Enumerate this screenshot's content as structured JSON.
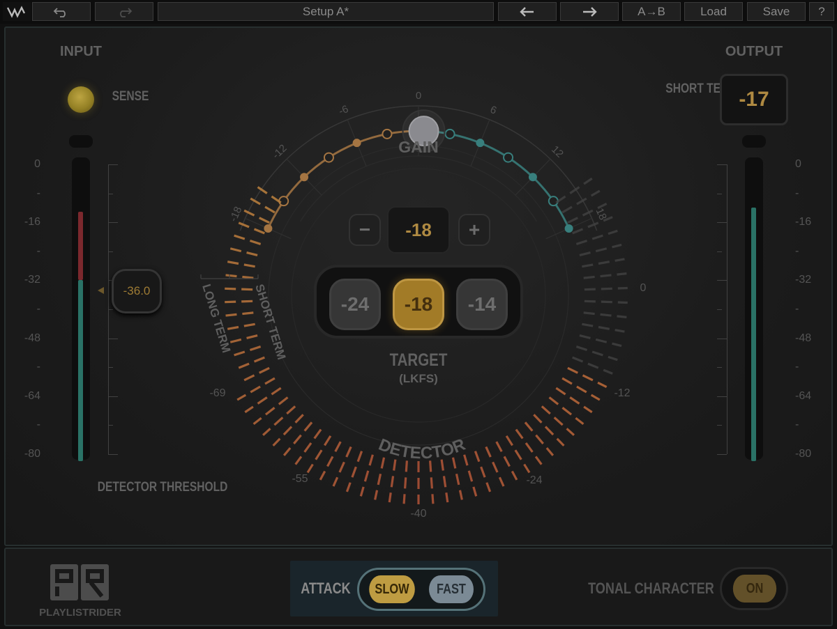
{
  "toolbar": {
    "logo_icon": "waves-logo-icon",
    "undo_icon": "undo-icon",
    "redo_icon": "redo-icon",
    "setup_name": "Setup A*",
    "prev_icon": "arrow-left-icon",
    "next_icon": "arrow-right-icon",
    "ab_label": "A→B",
    "load_label": "Load",
    "save_label": "Save",
    "help_label": "?"
  },
  "input": {
    "title": "INPUT",
    "sense_label": "SENSE",
    "meter_level_db": -32,
    "meter_peak_db": -13,
    "scale": [
      "0",
      "-16",
      "-32",
      "-48",
      "-64",
      "-80"
    ],
    "detector_threshold_value": "-36.0",
    "detector_threshold_label": "DETECTOR THRESHOLD"
  },
  "output": {
    "title": "OUTPUT",
    "short_term_label": "SHORT TERM",
    "short_term_value": "-17",
    "meter_level_db": -12,
    "scale": [
      "0",
      "-16",
      "-32",
      "-48",
      "-64",
      "-80"
    ]
  },
  "gain": {
    "label": "GAIN",
    "scale": [
      "-18",
      "-12",
      "-6",
      "0",
      "6",
      "12",
      "18"
    ],
    "value_db": 0.5
  },
  "target": {
    "minus_label": "−",
    "plus_label": "+",
    "value": "-18",
    "presets": [
      "-24",
      "-18",
      "-14"
    ],
    "selected_preset": "-18",
    "label": "TARGET",
    "unit": "(LKFS)"
  },
  "detector": {
    "label": "DETECTOR",
    "long_term_label": "LONG TERM",
    "short_term_label": "SHORT TERM",
    "scale_left": [
      "-69",
      "-55",
      "-40"
    ],
    "scale_right": [
      "0",
      "-12",
      "-24"
    ]
  },
  "bottom": {
    "logo_text": "PLAYLISTRIDER",
    "attack_label": "ATTACK",
    "attack_slow": "SLOW",
    "attack_fast": "FAST",
    "attack_selected": "SLOW",
    "tonal_label": "TONAL CHARACTER",
    "tonal_state": "ON"
  },
  "colors": {
    "accent_gold": "#c39a4a",
    "gain_left": "#b8834a",
    "gain_right": "#3f8e8c",
    "meter_green": "#2f7f72",
    "meter_red": "#8a2d33"
  }
}
